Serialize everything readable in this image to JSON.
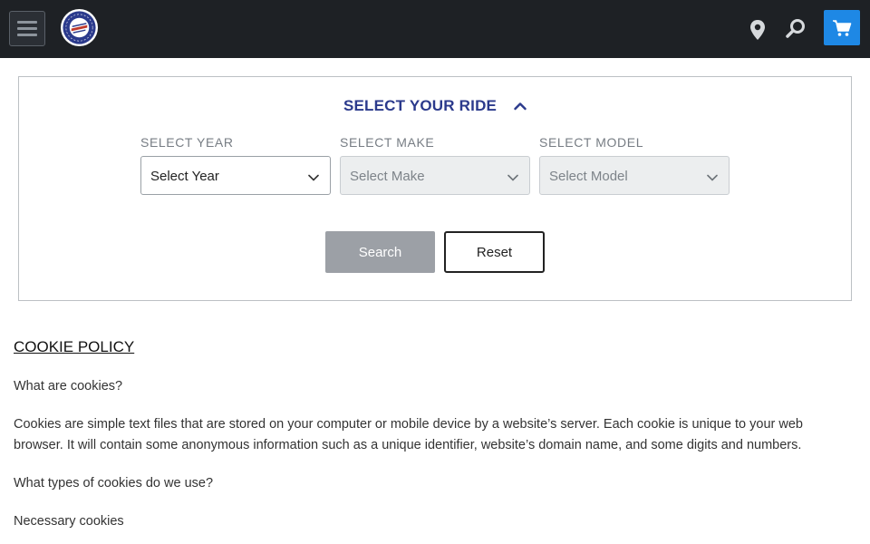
{
  "header": {
    "menu_icon": "hamburger-icon",
    "logo_text": "SEAT CONCEPTS",
    "location_icon": "map-pin-icon",
    "search_icon": "search-icon",
    "cart_icon": "cart-icon",
    "colors": {
      "bar": "#1e2125",
      "cart": "#1e88e5"
    }
  },
  "ride_selector": {
    "title": "SELECT YOUR RIDE",
    "toggle_icon": "chevron-up-icon",
    "title_color": "#2b3a8c",
    "year": {
      "label": "SELECT YEAR",
      "value": "Select Year"
    },
    "make": {
      "label": "SELECT MAKE",
      "value": "Select Make"
    },
    "model": {
      "label": "SELECT MODEL",
      "value": "Select Model"
    },
    "search_label": "Search",
    "reset_label": "Reset"
  },
  "policy": {
    "heading": "COOKIE POLICY",
    "q1": "What are cookies?",
    "p1": "Cookies are simple text files that are stored on your computer or mobile device by a website’s server. Each cookie is unique to your web browser. It will contain some anonymous information such as a unique identifier, website’s domain name, and some digits and numbers.",
    "q2": "What types of cookies do we use?",
    "q3": "Necessary cookies"
  }
}
